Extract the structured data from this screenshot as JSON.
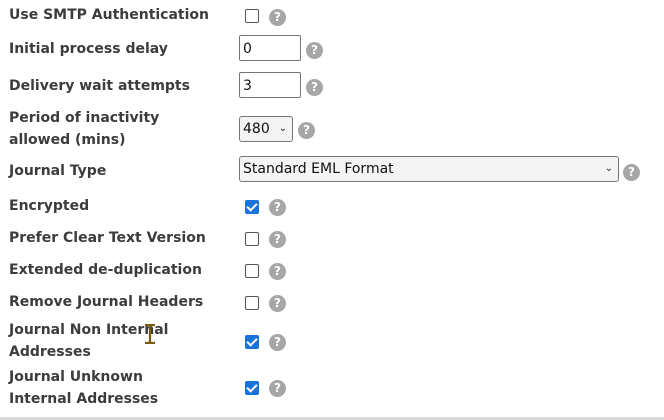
{
  "fields": [
    {
      "label": "Use SMTP Authentication",
      "checked": false
    },
    {
      "label": "Initial process delay",
      "value": "0"
    },
    {
      "label": "Delivery wait attempts",
      "value": "3"
    },
    {
      "label": "Period of inactivity allowed (mins)",
      "selected": "480"
    },
    {
      "label": "Journal Type",
      "selected": "Standard EML Format"
    },
    {
      "label": "Encrypted",
      "checked": true
    },
    {
      "label": "Prefer Clear Text Version",
      "checked": false
    },
    {
      "label": "Extended de-duplication",
      "checked": false
    },
    {
      "label": "Remove Journal Headers",
      "checked": false
    },
    {
      "label": "Journal Non Internal Addresses",
      "checked": true
    },
    {
      "label": "Journal Unknown Internal Addresses",
      "checked": true
    }
  ],
  "help_glyph": "?",
  "chevron_glyph": "⌄",
  "colors": {
    "accent": "#1a73d9",
    "help": "#a6a6a6",
    "label": "#3c3c3c"
  }
}
